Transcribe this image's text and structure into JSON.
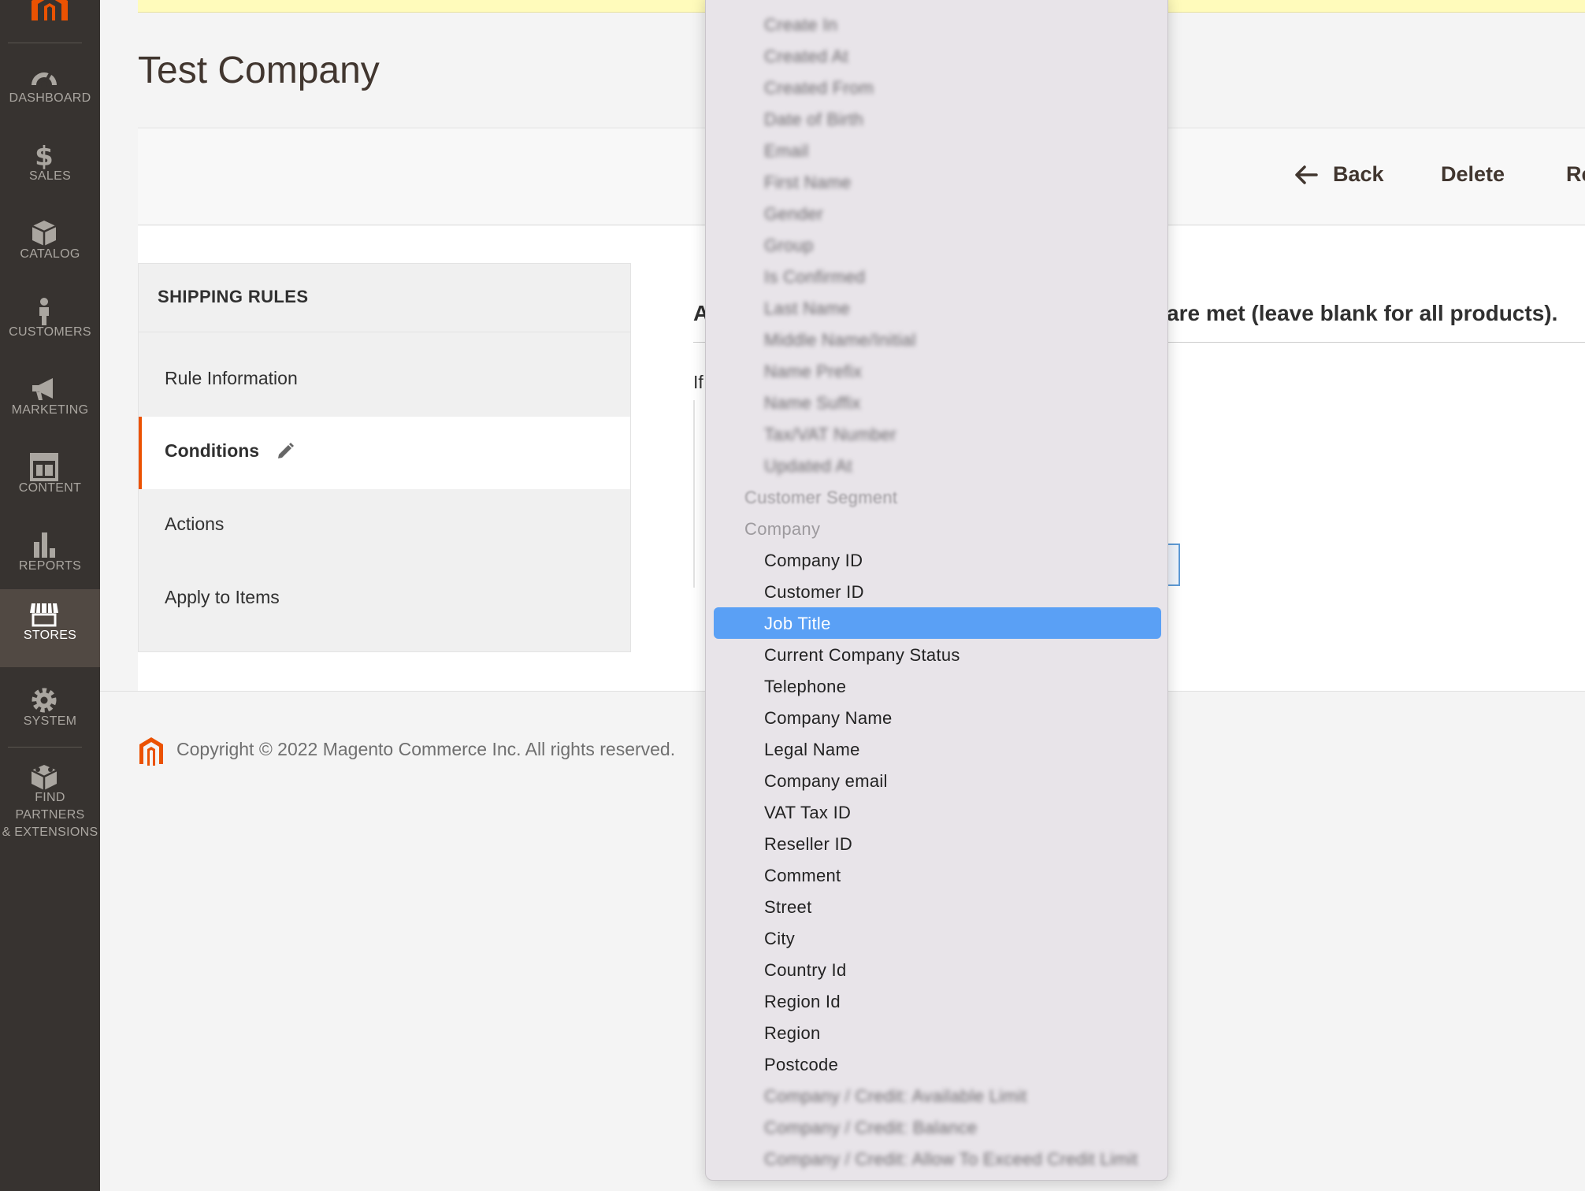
{
  "sidebar": {
    "items": [
      {
        "label": "DASHBOARD",
        "icon": "dashboard-icon"
      },
      {
        "label": "SALES",
        "icon": "dollar-icon"
      },
      {
        "label": "CATALOG",
        "icon": "box-icon"
      },
      {
        "label": "CUSTOMERS",
        "icon": "person-icon"
      },
      {
        "label": "MARKETING",
        "icon": "megaphone-icon"
      },
      {
        "label": "CONTENT",
        "icon": "layout-icon"
      },
      {
        "label": "REPORTS",
        "icon": "bar-chart-icon"
      },
      {
        "label": "STORES",
        "icon": "store-icon"
      },
      {
        "label": "SYSTEM",
        "icon": "gear-icon"
      }
    ],
    "partners_line1": "FIND PARTNERS",
    "partners_line2": "& EXTENSIONS"
  },
  "page": {
    "title": "Test Company",
    "back_label": "Back",
    "delete_label": "Delete",
    "reset_label": "Re"
  },
  "tabs": {
    "title": "SHIPPING RULES",
    "items": [
      {
        "label": "Rule Information"
      },
      {
        "label": "Conditions"
      },
      {
        "label": "Actions"
      },
      {
        "label": "Apply to Items"
      }
    ]
  },
  "section": {
    "heading_start": "A",
    "heading_end": "are met (leave blank for all products).",
    "if_text": "If"
  },
  "footer": {
    "copyright": "Copyright © 2022 Magento Commerce Inc. All rights reserved."
  },
  "dropdown": {
    "options": [
      {
        "label": "Create In",
        "kind": "blur"
      },
      {
        "label": "Created At",
        "kind": "blur"
      },
      {
        "label": "Created From",
        "kind": "blur"
      },
      {
        "label": "Date of Birth",
        "kind": "blur"
      },
      {
        "label": "Email",
        "kind": "blur"
      },
      {
        "label": "First Name",
        "kind": "blur"
      },
      {
        "label": "Gender",
        "kind": "blur"
      },
      {
        "label": "Group",
        "kind": "blur"
      },
      {
        "label": "Is Confirmed",
        "kind": "blur"
      },
      {
        "label": "Last Name",
        "kind": "blur"
      },
      {
        "label": "Middle Name/Initial",
        "kind": "blur"
      },
      {
        "label": "Name Prefix",
        "kind": "blur"
      },
      {
        "label": "Name Suffix",
        "kind": "blur"
      },
      {
        "label": "Tax/VAT Number",
        "kind": "blur"
      },
      {
        "label": "Updated At",
        "kind": "blur"
      },
      {
        "label": "Customer Segment",
        "kind": "group-blur"
      },
      {
        "label": "Company",
        "kind": "group"
      },
      {
        "label": "Company ID",
        "kind": "item"
      },
      {
        "label": "Customer ID",
        "kind": "item"
      },
      {
        "label": "Job Title",
        "kind": "selected"
      },
      {
        "label": "Current Company Status",
        "kind": "item"
      },
      {
        "label": "Telephone",
        "kind": "item"
      },
      {
        "label": "Company Name",
        "kind": "item"
      },
      {
        "label": "Legal Name",
        "kind": "item"
      },
      {
        "label": "Company email",
        "kind": "item"
      },
      {
        "label": "VAT Tax ID",
        "kind": "item"
      },
      {
        "label": "Reseller ID",
        "kind": "item"
      },
      {
        "label": "Comment",
        "kind": "item"
      },
      {
        "label": "Street",
        "kind": "item"
      },
      {
        "label": "City",
        "kind": "item"
      },
      {
        "label": "Country Id",
        "kind": "item"
      },
      {
        "label": "Region Id",
        "kind": "item"
      },
      {
        "label": "Region",
        "kind": "item"
      },
      {
        "label": "Postcode",
        "kind": "item"
      },
      {
        "label": "Company / Credit: Available Limit",
        "kind": "blur"
      },
      {
        "label": "Company / Credit: Balance",
        "kind": "blur"
      },
      {
        "label": "Company / Credit: Allow To Exceed Credit Limit",
        "kind": "blur"
      }
    ]
  },
  "colors": {
    "sidebar_bg": "#373330",
    "active_nav_bg": "#514943",
    "accent_orange": "#eb5202",
    "selection_blue": "#5aa0f5"
  }
}
